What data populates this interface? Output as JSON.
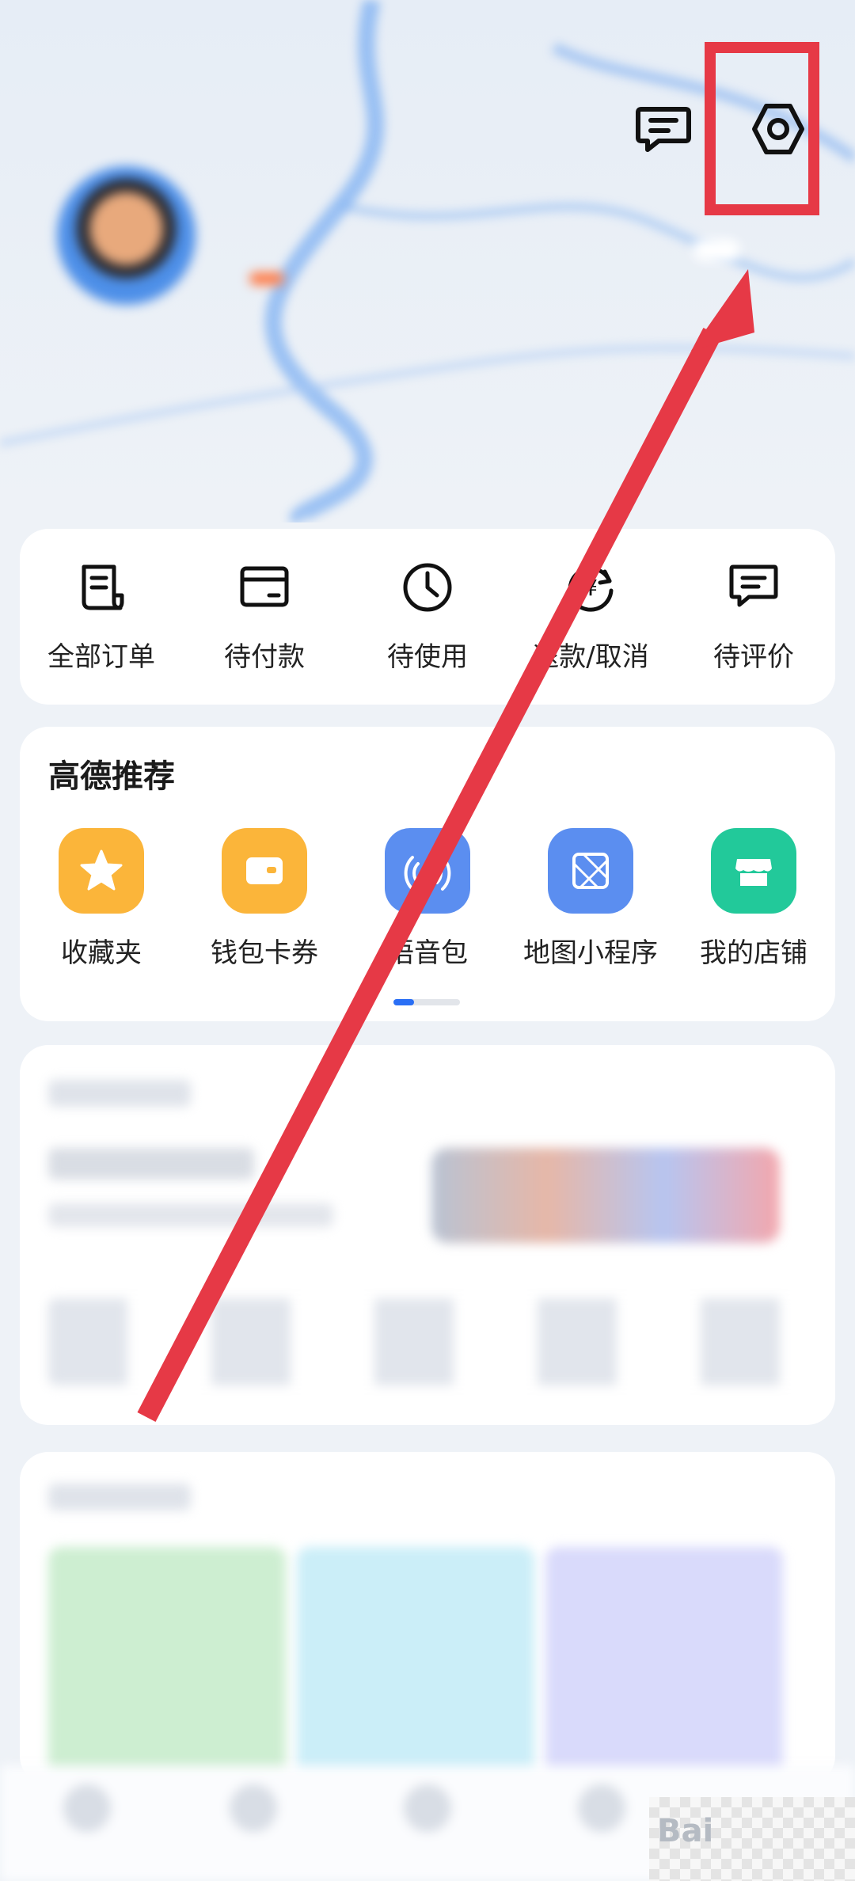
{
  "status_bar": {
    "time": "",
    "icons": ""
  },
  "header": {
    "message_icon": "message-icon",
    "settings_icon": "settings-hexagon-icon"
  },
  "profile": {
    "username": "",
    "level_badge": "",
    "profile_button": ""
  },
  "stats": [
    {
      "num": "",
      "label": ""
    },
    {
      "num": "",
      "label": ""
    },
    {
      "num": "",
      "label": ""
    },
    {
      "num": "",
      "label": ""
    }
  ],
  "orders": {
    "items": [
      {
        "label": "全部订单",
        "icon": "order-list-icon"
      },
      {
        "label": "待付款",
        "icon": "wallet-card-icon"
      },
      {
        "label": "待使用",
        "icon": "clock-icon"
      },
      {
        "label": "退款/取消",
        "icon": "refund-icon"
      },
      {
        "label": "待评价",
        "icon": "comment-icon"
      }
    ]
  },
  "recommend": {
    "title": "高德推荐",
    "items": [
      {
        "label": "收藏夹",
        "icon": "star-icon",
        "color": "#fbb53a"
      },
      {
        "label": "钱包卡券",
        "icon": "wallet-icon",
        "color": "#fbb53a"
      },
      {
        "label": "语音包",
        "icon": "voice-pack-icon",
        "color": "#5b8ef0"
      },
      {
        "label": "地图小程序",
        "icon": "mini-program-icon",
        "color": "#5b8ef0"
      },
      {
        "label": "我的店铺",
        "icon": "shop-icon",
        "color": "#22c99a"
      }
    ],
    "page_index": 1,
    "page_count": 3
  },
  "annotation": {
    "highlight_color": "#e63946",
    "arrow_color": "#e63946"
  },
  "watermark": {
    "text": "Bai"
  }
}
